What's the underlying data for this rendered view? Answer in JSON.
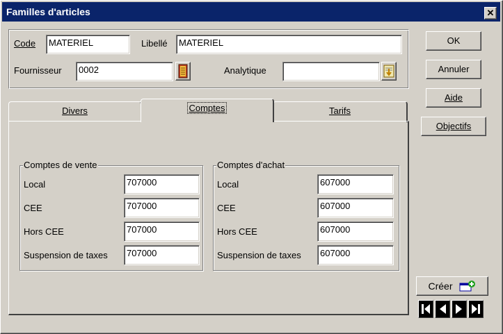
{
  "window": {
    "title": "Familles d'articles",
    "close_label": "✕"
  },
  "header": {
    "code_label": "Code",
    "code_value": "MATERIEL",
    "libelle_label": "Libellé",
    "libelle_value": "MATERIEL",
    "fournisseur_label": "Fournisseur",
    "fournisseur_value": "0002",
    "analytique_label": "Analytique",
    "analytique_value": ""
  },
  "buttons": {
    "ok": "OK",
    "annuler": "Annuler",
    "aide": "Aide",
    "objectifs": "Objectifs",
    "creer": "Créer"
  },
  "tabs": [
    {
      "label": "Divers",
      "active": false
    },
    {
      "label": "Comptes",
      "active": true
    },
    {
      "label": "Tarifs",
      "active": false
    }
  ],
  "comptes_vente": {
    "title": "Comptes de vente",
    "rows": [
      {
        "label": "Local",
        "value": "707000"
      },
      {
        "label": "CEE",
        "value": "707000"
      },
      {
        "label": "Hors CEE",
        "value": "707000"
      },
      {
        "label": "Suspension de taxes",
        "value": "707000"
      }
    ]
  },
  "comptes_achat": {
    "title": "Comptes d'achat",
    "rows": [
      {
        "label": "Local",
        "value": "607000"
      },
      {
        "label": "CEE",
        "value": "607000"
      },
      {
        "label": "Hors CEE",
        "value": "607000"
      },
      {
        "label": "Suspension de taxes",
        "value": "607000"
      }
    ]
  },
  "icons": {
    "fournisseur_lookup": "book-icon",
    "analytique_lookup": "arrow-down-list-icon",
    "creer": "new-record-icon",
    "nav": [
      "first-record-icon",
      "previous-record-icon",
      "next-record-icon",
      "last-record-icon"
    ]
  }
}
